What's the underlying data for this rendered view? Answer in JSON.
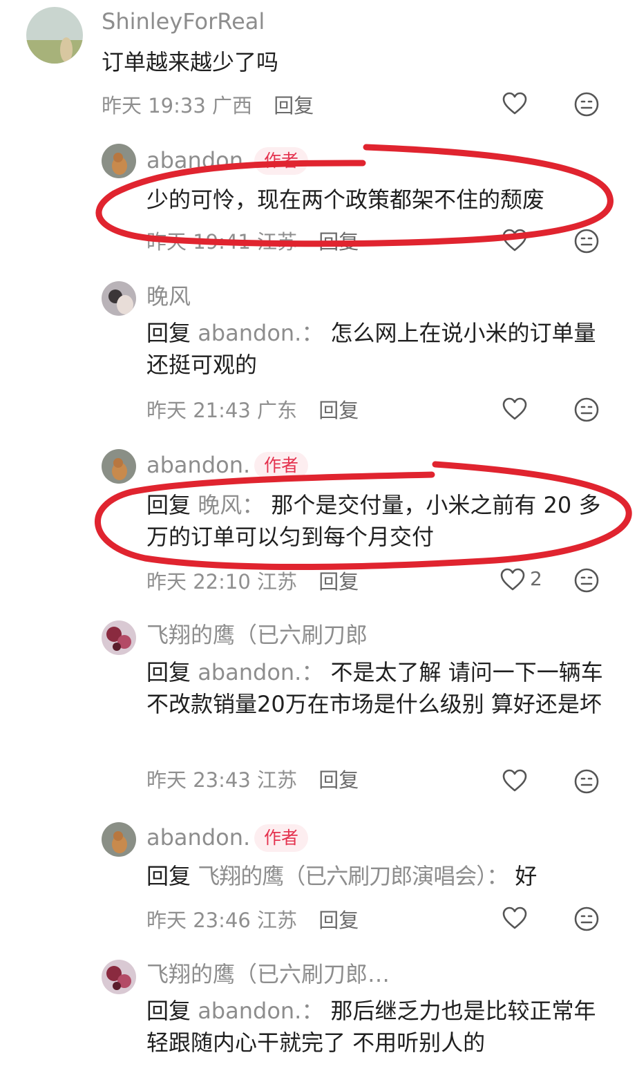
{
  "labels": {
    "reply": "回复",
    "author_tag": "作者"
  },
  "comments": [
    {
      "user": "ShinleyForReal",
      "text": "订单越来越少了吗",
      "time": "昨天 19:33",
      "location": "广西"
    },
    {
      "user": "abandon.",
      "author_tag": "作者",
      "text": "少的可怜，现在两个政策都架不住的颓废",
      "time": "昨天 19:41",
      "location": "江苏"
    },
    {
      "user": "晚风",
      "reply_prefix": "回复",
      "reply_to": "abandon.：",
      "text": "怎么网上在说小米的订单量还挺可观的",
      "time": "昨天 21:43",
      "location": "广东"
    },
    {
      "user": "abandon.",
      "author_tag": "作者",
      "reply_prefix": "回复",
      "reply_to": "晚风：",
      "text": "那个是交付量，小米之前有 20 多万的订单可以匀到每个月交付",
      "time": "昨天 22:10",
      "location": "江苏",
      "likes": "2"
    },
    {
      "user": "飞翔的鹰（已六刷刀郎",
      "reply_prefix": "回复",
      "reply_to": "abandon.：",
      "text": "不是太了解 请问一下一辆车不改款销量20万在市场是什么级别 算好还是坏",
      "time": "昨天 23:43",
      "location": "江苏"
    },
    {
      "user": "abandon.",
      "author_tag": "作者",
      "reply_prefix": "回复",
      "reply_to": "飞翔的鹰（已六刷刀郎演唱会）：",
      "text": "好",
      "time": "昨天 23:46",
      "location": "江苏"
    },
    {
      "user": "飞翔的鹰（已六刷刀郎…",
      "reply_prefix": "回复",
      "reply_to": "abandon.：",
      "text": "那后继乏力也是比较正常年轻跟随内心干就完了 不用听别人的"
    }
  ],
  "colors": {
    "annotation": "#e0242f",
    "author_tag_bg": "#fdeef0",
    "author_tag_text": "#e4324e"
  },
  "icons": {
    "like": "heart-outline-icon",
    "dislike": "meh-face-icon"
  }
}
